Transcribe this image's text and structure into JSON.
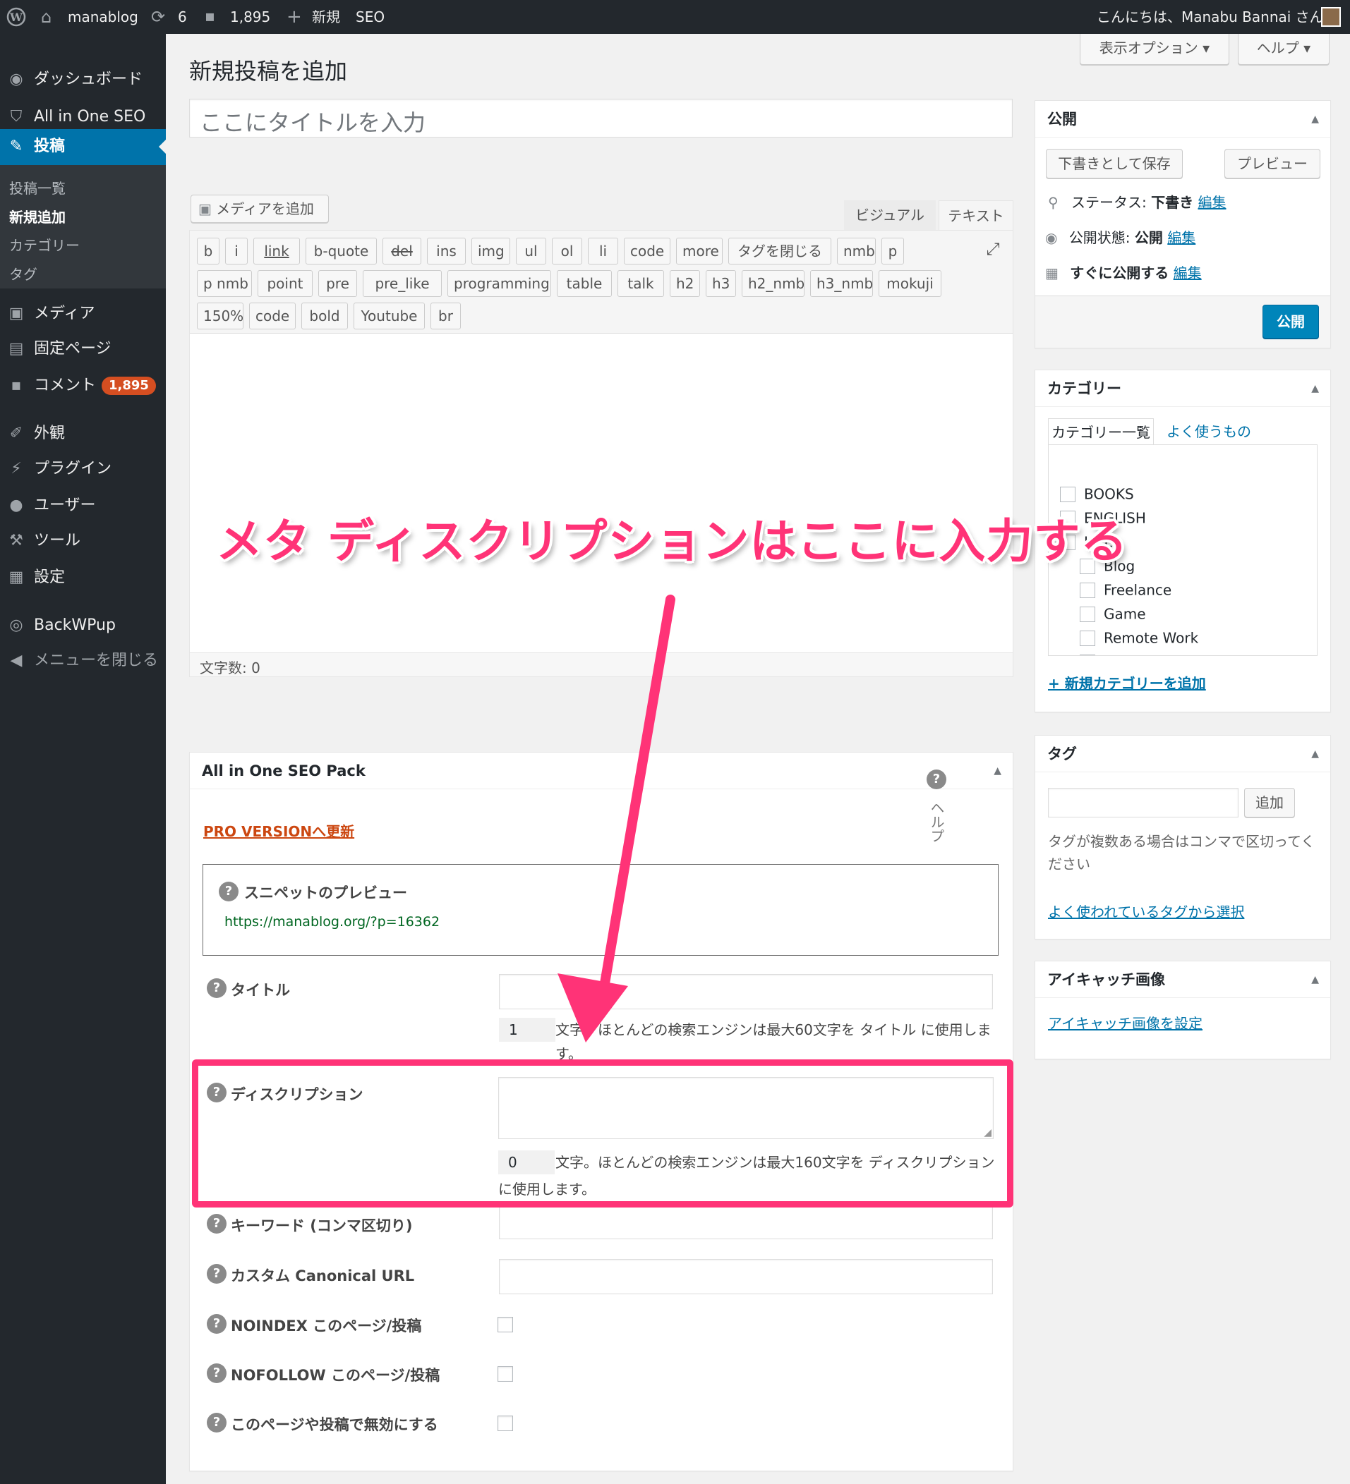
{
  "adminbar": {
    "site_name": "manablog",
    "updates": "6",
    "comments": "1,895",
    "new": "新規",
    "seo": "SEO",
    "greeting": "こんにちは、Manabu Bannai さん"
  },
  "sidebar": {
    "dashboard": "ダッシュボード",
    "aioseo": "All in One SEO",
    "posts": "投稿",
    "sub": {
      "all": "投稿一覧",
      "new": "新規追加",
      "categories": "カテゴリー",
      "tags": "タグ"
    },
    "media": "メディア",
    "pages": "固定ページ",
    "comments": "コメント",
    "comments_count": "1,895",
    "appearance": "外観",
    "plugins": "プラグイン",
    "users": "ユーザー",
    "tools": "ツール",
    "settings": "設定",
    "backwpup": "BackWPup",
    "collapse": "メニューを閉じる"
  },
  "header": {
    "title": "新規投稿を追加",
    "screen_options": "表示オプション ▾",
    "help": "ヘルプ ▾"
  },
  "editor": {
    "title_placeholder": "ここにタイトルを入力",
    "add_media": "メディアを追加",
    "tab_visual": "ビジュアル",
    "tab_text": "テキスト",
    "word_count": "文字数: 0",
    "quicktags_row1": [
      "b",
      "i",
      "link",
      "b-quote",
      "del",
      "ins",
      "img",
      "ul",
      "ol",
      "li",
      "code",
      "more",
      "タグを閉じる",
      "nmb",
      "p"
    ],
    "quicktags_row2": [
      "p nmb",
      "point",
      "pre",
      "pre_like",
      "programming",
      "table",
      "talk",
      "h2",
      "h3",
      "h2_nmb",
      "h3_nmb",
      "mokuji"
    ],
    "quicktags_row3": [
      "150%",
      "code",
      "bold",
      "Youtube",
      "br"
    ]
  },
  "annotation": {
    "text": "メタ ディスクリプションはここに入力する",
    "color": "#ff3377"
  },
  "seo_box": {
    "title": "All in One SEO Pack",
    "help_label": "ヘルプ",
    "pro": "PRO VERSIONへ更新",
    "snippet_label": "スニペットのプレビュー",
    "snippet_url": "https://manablog.org/?p=16362",
    "title_label": "タイトル",
    "title_count": "1",
    "title_hint": "文字。ほとんどの検索エンジンは最大60文字を タイトル に使用します。",
    "desc_label": "ディスクリプション",
    "desc_count": "0",
    "desc_hint1": "文字。ほとんどの検索エンジンは最大160文字を ディスクリプション",
    "desc_hint2": "に使用します。",
    "keywords_label": "キーワード (コンマ区切り)",
    "canonical_label": "カスタム Canonical URL",
    "noindex_label": "NOINDEX このページ/投稿",
    "nofollow_label": "NOFOLLOW このページ/投稿",
    "disable_label": "このページや投稿で無効にする"
  },
  "publish": {
    "title": "公開",
    "save_draft": "下書きとして保存",
    "preview": "プレビュー",
    "status_label": "ステータス:",
    "status_value": "下書き",
    "visibility_label": "公開状態:",
    "visibility_value": "公開",
    "schedule": "すぐに公開する",
    "edit": "編集",
    "publish_button": "公開"
  },
  "categories": {
    "title": "カテゴリー",
    "tab_all": "カテゴリー一覧",
    "tab_popular": "よく使うもの",
    "items": [
      "BOOKS",
      "ENGLISH",
      "LIFE",
      "Blog",
      "Freelance",
      "Game",
      "Remote Work",
      "Work"
    ],
    "add_new": "+ 新規カテゴリーを追加"
  },
  "tags": {
    "title": "タグ",
    "add": "追加",
    "hint": "タグが複数ある場合はコンマで区切ってください",
    "hint1": "タグが複数ある場合はコンマで区切ってく",
    "hint2": "ださい",
    "choose": "よく使われているタグから選択"
  },
  "featured": {
    "title": "アイキャッチ画像",
    "set": "アイキャッチ画像を設定"
  }
}
